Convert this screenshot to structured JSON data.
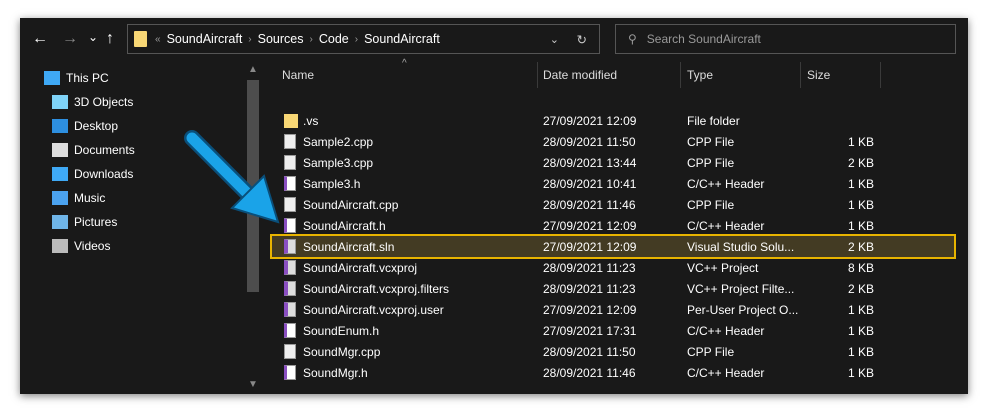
{
  "nav": {
    "back": "←",
    "forward": "→",
    "recent": "⌄",
    "up": "↑"
  },
  "address": {
    "prefix": "«",
    "crumbs": [
      "SoundAircraft",
      "Sources",
      "Code",
      "SoundAircraft"
    ]
  },
  "search": {
    "placeholder": "Search SoundAircraft"
  },
  "sidebar": [
    {
      "label": "This PC",
      "icon": "pc-icon"
    },
    {
      "label": "3D Objects",
      "icon": "cube-icon"
    },
    {
      "label": "Desktop",
      "icon": "desktop-icon"
    },
    {
      "label": "Documents",
      "icon": "document-icon"
    },
    {
      "label": "Downloads",
      "icon": "download-icon"
    },
    {
      "label": "Music",
      "icon": "music-icon"
    },
    {
      "label": "Pictures",
      "icon": "pictures-icon"
    },
    {
      "label": "Videos",
      "icon": "video-icon"
    }
  ],
  "columns": {
    "name": "Name",
    "date": "Date modified",
    "type": "Type",
    "size": "Size"
  },
  "files": [
    {
      "name": ".vs",
      "date": "27/09/2021 12:09",
      "type": "File folder",
      "size": "",
      "icon": "folder"
    },
    {
      "name": "Sample2.cpp",
      "date": "28/09/2021 11:50",
      "type": "CPP File",
      "size": "1 KB",
      "icon": "file"
    },
    {
      "name": "Sample3.cpp",
      "date": "28/09/2021 13:44",
      "type": "CPP File",
      "size": "2 KB",
      "icon": "file"
    },
    {
      "name": "Sample3.h",
      "date": "28/09/2021 10:41",
      "type": "C/C++ Header",
      "size": "1 KB",
      "icon": "h"
    },
    {
      "name": "SoundAircraft.cpp",
      "date": "28/09/2021 11:46",
      "type": "CPP File",
      "size": "1 KB",
      "icon": "file"
    },
    {
      "name": "SoundAircraft.h",
      "date": "27/09/2021 12:09",
      "type": "C/C++ Header",
      "size": "1 KB",
      "icon": "h"
    },
    {
      "name": "SoundAircraft.sln",
      "date": "27/09/2021 12:09",
      "type": "Visual Studio Solu...",
      "size": "2 KB",
      "icon": "vs",
      "selected": true
    },
    {
      "name": "SoundAircraft.vcxproj",
      "date": "28/09/2021 11:23",
      "type": "VC++ Project",
      "size": "8 KB",
      "icon": "vs"
    },
    {
      "name": "SoundAircraft.vcxproj.filters",
      "date": "28/09/2021 11:23",
      "type": "VC++ Project Filte...",
      "size": "2 KB",
      "icon": "vs"
    },
    {
      "name": "SoundAircraft.vcxproj.user",
      "date": "27/09/2021 12:09",
      "type": "Per-User Project O...",
      "size": "1 KB",
      "icon": "vs"
    },
    {
      "name": "SoundEnum.h",
      "date": "27/09/2021 17:31",
      "type": "C/C++ Header",
      "size": "1 KB",
      "icon": "h"
    },
    {
      "name": "SoundMgr.cpp",
      "date": "28/09/2021 11:50",
      "type": "CPP File",
      "size": "1 KB",
      "icon": "file"
    },
    {
      "name": "SoundMgr.h",
      "date": "28/09/2021 11:46",
      "type": "C/C++ Header",
      "size": "1 KB",
      "icon": "h"
    }
  ],
  "colors": {
    "highlight": "#e8b400",
    "arrow": "#1aa3e8"
  }
}
